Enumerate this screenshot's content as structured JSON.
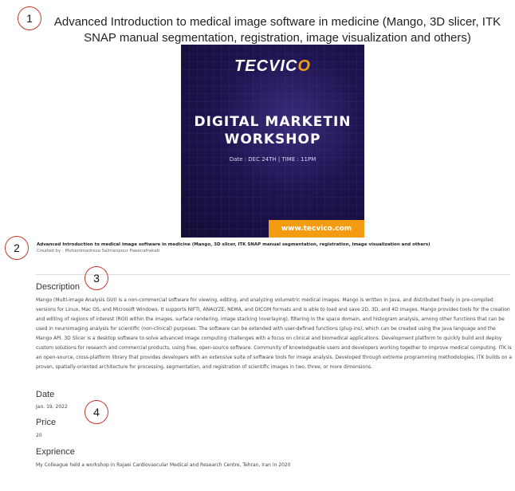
{
  "annotations": {
    "a1": "1",
    "a2": "2",
    "a3": "3",
    "a4": "4"
  },
  "course": {
    "title": "Advanced Introduction to medical image software in medicine (Mango, 3D slicer, ITK SNAP manual segmentation, registration, image visualization and others)",
    "caption": "Advanced Introduction to medical image software in medicine (Mango, 3D slicer, ITK SNAP manual segmentation, registration, image visualization and others)",
    "creator": "Created by : Mohammadreza Salmanpour Paeenafrakati"
  },
  "poster": {
    "brand_main": "TECVIC",
    "brand_accent": "O",
    "headline_line1": "DIGITAL MARKETIN",
    "headline_line2": "WORKSHOP",
    "date_line": "Date : DEC 24TH  |  TIME : 11PM",
    "url": "www.tecvico.com"
  },
  "sections": {
    "description_heading": "Description",
    "description_text": "Mango (Multi-image Analysis GUI) is a non-commercial software for viewing, editing, and analyzing volumetric medical images. Mango is written in Java, and distributed freely in pre-compiled versions for Linux, Mac OS, and Microsoft Windows. It supports NIFTI, ANALYZE, NEMA, and DICOM formats and is able to load and save 2D, 3D, and 4D images. Mango provides tools for the creation and editing of regions of interest (ROI) within the images, surface rendering, image stacking (overlaying), filtering in the space domain, and histogram analysis, among other functions that can be used in neuroimaging analysis for scientific (non-clinical) purposes. The software can be extended with user-defined functions (plug-ins), which can be created using the Java language and the Mango API. 3D Slicer is a desktop software to solve advanced image computing challenges with a focus on clinical and biomedical applications. Development platform to quickly build and deploy custom solutions for research and commercial products, using free, open-source software. Community of knowledgeable users and developers working together to improve medical computing. ITK is an open-source, cross-platform library that provides developers with an extensive suite of software tools for image analysis. Developed through extreme programming methodologies, ITK builds on a proven, spatially-oriented architecture for processing, segmentation, and registration of scientific images in two, three, or more dimensions.",
    "date_heading": "Date",
    "date_value": "Jan. 19, 2022",
    "price_heading": "Price",
    "price_value": "20",
    "experience_heading": "Exprience",
    "experience_text": "My Colleague held a workshop in Rajaei Cardiovascular Medical and Research Centre, Tehran, Iran in 2020"
  }
}
